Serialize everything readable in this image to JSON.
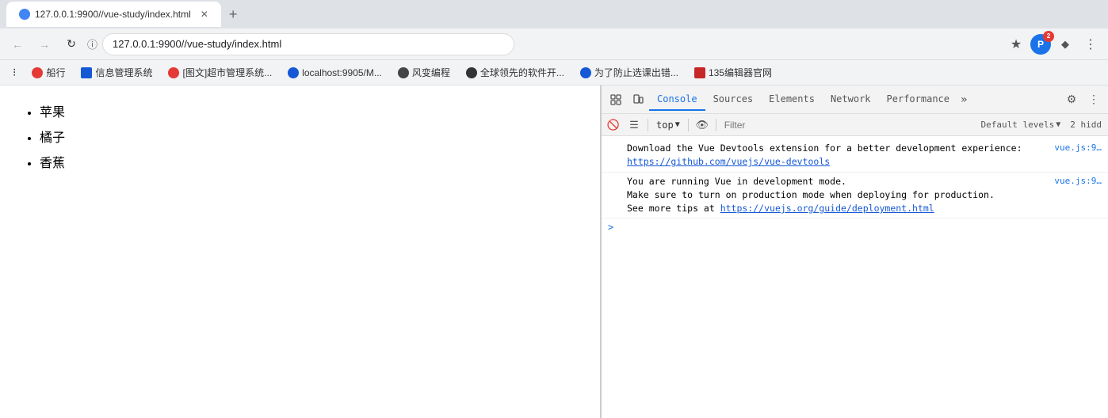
{
  "browser": {
    "url": "127.0.0.1:9900//vue-study/index.html",
    "tab_title": "127.0.0.1:9900//vue-study/index.html"
  },
  "bookmarks": [
    {
      "label": "应用",
      "icon_color": "#4285f4"
    },
    {
      "label": "船行",
      "icon_color": "#e53935"
    },
    {
      "label": "信息管理系统",
      "icon_color": "#1558d6"
    },
    {
      "label": "[图文]超市管理系统...",
      "icon_color": "#e53935"
    },
    {
      "label": "localhost:9905/M...",
      "icon_color": "#1558d6"
    },
    {
      "label": "风变编程",
      "icon_color": "#444"
    },
    {
      "label": "全球领先的软件开...",
      "icon_color": "#333"
    },
    {
      "label": "为了防止选课出错...",
      "icon_color": "#1558d6"
    },
    {
      "label": "135编辑器官网",
      "icon_color": "#c62828"
    }
  ],
  "page": {
    "list_items": [
      "苹果",
      "橘子",
      "香蕉"
    ]
  },
  "devtools": {
    "tabs": [
      {
        "label": "Console",
        "active": true
      },
      {
        "label": "Sources",
        "active": false
      },
      {
        "label": "Elements",
        "active": false
      },
      {
        "label": "Network",
        "active": false
      },
      {
        "label": "Performance",
        "active": false
      }
    ],
    "console": {
      "context": "top",
      "filter_placeholder": "Filter",
      "levels": "Default levels",
      "hidden_count": "2 hidd",
      "messages": [
        {
          "text": "Download the Vue Devtools extension for a better development experience:\nhttps://github.com/vuejs/vue-devtools",
          "link": "https://github.com/vuejs/vue-devtools",
          "source": "vue.js:9"
        },
        {
          "text": "You are running Vue in development mode.\nMake sure to turn on production mode when deploying for production.\nSee more tips at https://vuejs.org/guide/deployment.html",
          "link": "https://vuejs.org/guide/deployment.html",
          "source": "vue.js:9"
        }
      ]
    }
  }
}
